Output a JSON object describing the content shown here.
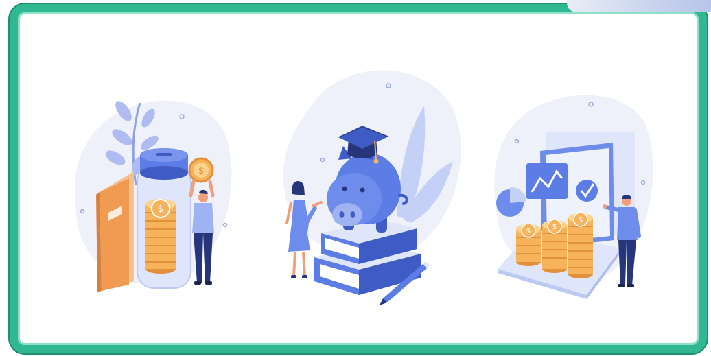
{
  "colors": {
    "frame": "#2fb892",
    "blob": "#eef1fa",
    "primary": "#5c7ce6",
    "primary_dark": "#3f5cc4",
    "coin": "#f6b35c",
    "coin_dark": "#e2913a",
    "book": "#f19b52",
    "plant": "#aebcf2",
    "skin": "#f2a07b",
    "pants": "#27367a"
  },
  "icons": {
    "savings_jar": "savings-jar-icon",
    "piggy_bank": "piggy-bank-icon",
    "investment": "laptop-chart-icon",
    "coin": "dollar-coin-icon"
  },
  "coin_symbol": "$"
}
